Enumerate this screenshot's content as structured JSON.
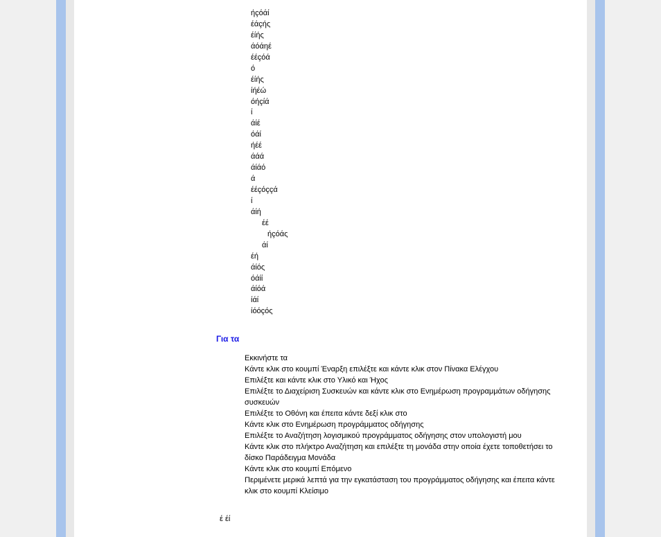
{
  "vert": [
    {
      "t": "ήçόάί",
      "cls": ""
    },
    {
      "t": "έάçής",
      "cls": ""
    },
    {
      "t": "έίής",
      "cls": ""
    },
    {
      "t": "άόάηέ",
      "cls": ""
    },
    {
      "t": "έέçόά",
      "cls": ""
    },
    {
      "t": "ό",
      "cls": ""
    },
    {
      "t": "έίής",
      "cls": ""
    },
    {
      "t": "ίήέώ",
      "cls": ""
    },
    {
      "t": "όήçίά",
      "cls": ""
    },
    {
      "t": "ί",
      "cls": ""
    },
    {
      "t": "άίέ",
      "cls": ""
    },
    {
      "t": "όάί",
      "cls": ""
    },
    {
      "t": "ήέέ",
      "cls": ""
    },
    {
      "t": "άάά",
      "cls": ""
    },
    {
      "t": "άίάό",
      "cls": ""
    },
    {
      "t": "ά",
      "cls": ""
    },
    {
      "t": "έέçόççά",
      "cls": ""
    },
    {
      "t": "ί",
      "cls": ""
    },
    {
      "t": "άίή",
      "cls": ""
    },
    {
      "t": "έέ",
      "cls": "indent1"
    },
    {
      "t": "ήçόάς",
      "cls": "indent2"
    },
    {
      "t": "άί",
      "cls": "indent1"
    },
    {
      "t": "έή",
      "cls": ""
    },
    {
      "t": "άίός",
      "cls": ""
    },
    {
      "t": "όάίί",
      "cls": ""
    },
    {
      "t": "άίόά",
      "cls": ""
    },
    {
      "t": "ίάί",
      "cls": ""
    },
    {
      "t": "ίόόçός",
      "cls": ""
    }
  ],
  "heading": "Για τα",
  "instructions": [
    "Εκκινήστε τα",
    "Κάντε κλικ στο κουμπί Έναρξη  επιλέξτε και κάντε κλικ στον  Πίνακα Ελέγχου",
    "Επιλέξτε και κάντε κλικ στο  Υλικό και Ήχος",
    "Επιλέξτε το  Διαχείριση Συσκευών  και κάντε κλικ στο  Ενημέρωση προγραμμάτων οδήγησης συσκευών",
    "Επιλέξτε το  Οθόνη  και έπειτα κάντε δεξί κλικ στο",
    "Κάντε κλικ στο  Ενημέρωση προγράμματος οδήγησης",
    "Επιλέξτε το  Αναζήτηση λογισμικού προγράμματος οδήγησης στον υπολογιστή μου",
    "Κάντε κλικ στο πλήκτρο  Αναζήτηση  και επιλέξτε τη μονάδα στην οποία έχετε τοποθετήσει το δίσκο  Παράδειγμα  Μονάδα",
    "Κάντε κλικ στο κουμπί  Επόμενο",
    "Περιμένετε μερικά λεπτά για την εγκατάσταση του προγράμματος οδήγησης και έπειτα κάντε κλικ στο κουμπί  Κλείσιμο"
  ],
  "footer": "έ   έί"
}
